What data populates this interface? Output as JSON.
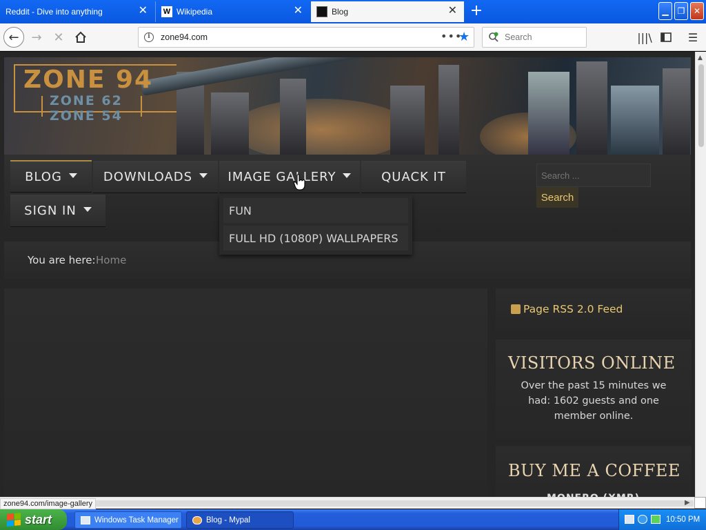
{
  "browser": {
    "tabs": [
      {
        "title": "Reddit - Dive into anything",
        "active": false
      },
      {
        "title": "Wikipedia",
        "active": false,
        "favicon": "W"
      },
      {
        "title": "Blog",
        "active": true
      }
    ],
    "url": "zone94.com",
    "search_placeholder": "Search",
    "status_url": "zone94.com/image-gallery",
    "accent_color": "#1473e6"
  },
  "site": {
    "logo_main": "ZONE 94",
    "logo_sub1": "ZONE 62",
    "logo_sub2": "ZONE 54",
    "menu": [
      {
        "label": "BLOG",
        "has_caret": true
      },
      {
        "label": "DOWNLOADS",
        "has_caret": true
      },
      {
        "label": "IMAGE GALLERY",
        "has_caret": true
      },
      {
        "label": "QUACK IT",
        "has_caret": false
      },
      {
        "label": "SIGN IN",
        "has_caret": true
      }
    ],
    "dropdown": [
      "FUN",
      "FULL HD (1080P) WALLPAPERS"
    ],
    "search_placeholder": "Search ...",
    "search_button": "Search",
    "breadcrumb": {
      "label": "You are here:",
      "home": "Home"
    },
    "rss": "Page RSS 2.0 Feed",
    "visitors": {
      "title": "VISITORS ONLINE",
      "body": "Over the past 15 minutes we had: 1602 guests and one member online."
    },
    "coffee": {
      "title": "BUY ME A COFFEE",
      "sub": "MONERO (XMR)"
    },
    "accent_gold": "#e8c873"
  },
  "taskbar": {
    "start": "start",
    "tasks": [
      "Windows Task Manager",
      "Blog - Mypal"
    ],
    "clock": "10:50 PM"
  }
}
